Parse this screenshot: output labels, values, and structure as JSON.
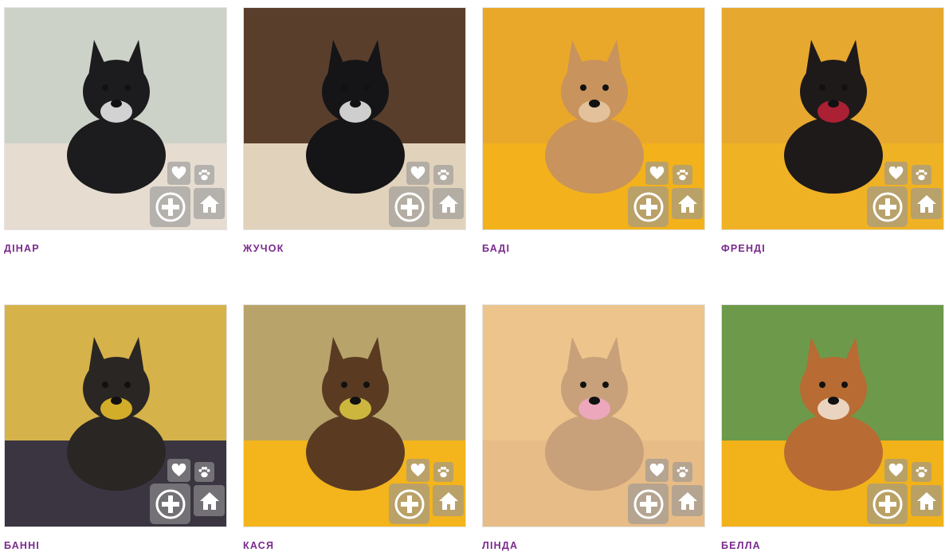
{
  "pets": [
    {
      "name": "ДІНАР",
      "colors": {
        "bg": "#cdd2c8",
        "ground": "#e6dcd0",
        "body": "#1c1c1e",
        "accent": "#f2f2f2"
      }
    },
    {
      "name": "ЖУЧОК",
      "colors": {
        "bg": "#5a3e2c",
        "ground": "#e1d2bc",
        "body": "#151517",
        "accent": "#eeeeee"
      }
    },
    {
      "name": "БАДІ",
      "colors": {
        "bg": "#e9a82a",
        "ground": "#f3b21b",
        "body": "#c8935c",
        "accent": "#e8c9a4"
      }
    },
    {
      "name": "ФРЕНДІ",
      "colors": {
        "bg": "#e7a830",
        "ground": "#f0b225",
        "body": "#1e1a1a",
        "accent": "#c62238"
      }
    },
    {
      "name": "БАННІ",
      "colors": {
        "bg": "#d6b24a",
        "ground": "#3a3540",
        "body": "#2a2624",
        "accent": "#f0c52a"
      }
    },
    {
      "name": "КАСЯ",
      "colors": {
        "bg": "#b8a46a",
        "ground": "#f3b41c",
        "body": "#5a3b22",
        "accent": "#e2cc43"
      }
    },
    {
      "name": "ЛІНДА",
      "colors": {
        "bg": "#ecc48c",
        "ground": "#e7bc86",
        "body": "#c8a07a",
        "accent": "#f2a8c8"
      }
    },
    {
      "name": "БЕЛЛА",
      "colors": {
        "bg": "#6c9a4a",
        "ground": "#f2b21a",
        "body": "#b86b32",
        "accent": "#f2e6d8"
      }
    }
  ],
  "icons": {
    "favorite": "heart-icon",
    "paw": "paw-icon",
    "add": "plus-circle-icon",
    "home": "house-icon"
  }
}
